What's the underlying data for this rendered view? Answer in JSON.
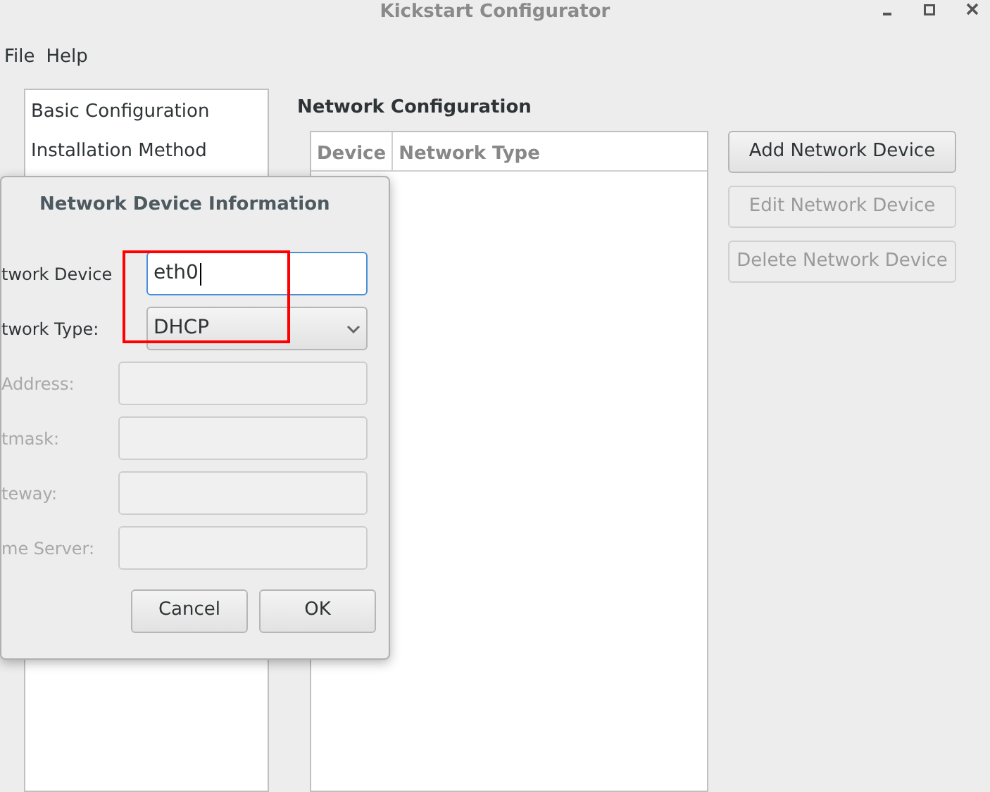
{
  "window": {
    "title": "Kickstart Configurator"
  },
  "menu": [
    "File",
    "Help"
  ],
  "sidebar": {
    "items": [
      {
        "label": "Basic Configuration",
        "selected": false
      },
      {
        "label": "Installation Method",
        "selected": false
      }
    ]
  },
  "section": {
    "title": "Network Configuration"
  },
  "table": {
    "columns": [
      "Device",
      "Network Type"
    ]
  },
  "buttons": [
    {
      "label": "Add Network Device",
      "disabled": false
    },
    {
      "label": "Edit Network Device",
      "disabled": true
    },
    {
      "label": "Delete Network Device",
      "disabled": true
    }
  ],
  "dialog": {
    "title": "Network Device Information",
    "fields": [
      {
        "label": "twork Device",
        "kind": "text",
        "value": "eth0",
        "disabled": false,
        "focused": true
      },
      {
        "label": "twork Type:",
        "kind": "combo",
        "value": "DHCP",
        "disabled": false,
        "focused": false
      },
      {
        "label": "Address:",
        "kind": "text",
        "disabled": true,
        "focused": false
      },
      {
        "label": "tmask:",
        "kind": "text",
        "disabled": true,
        "focused": false
      },
      {
        "label": "teway:",
        "kind": "text",
        "disabled": true,
        "focused": false
      },
      {
        "label": "me Server:",
        "kind": "text",
        "disabled": true,
        "focused": false
      }
    ],
    "buttons": [
      "Cancel",
      "OK"
    ]
  }
}
